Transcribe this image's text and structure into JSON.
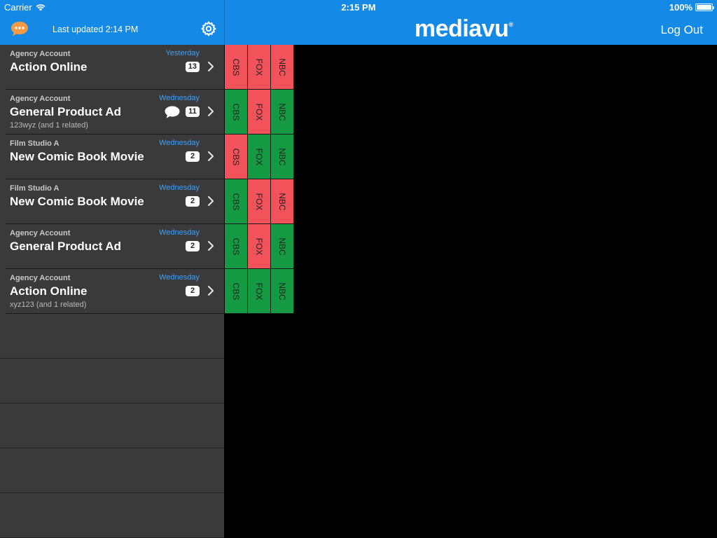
{
  "status": {
    "carrier": "Carrier",
    "time": "2:15 PM",
    "battery": "100%"
  },
  "header": {
    "last_updated": "Last updated 2:14 PM",
    "logo": "mediavu",
    "logo_mark": "®",
    "logout": "Log Out"
  },
  "colors": {
    "accent": "#1589e6",
    "red": "#f2525a",
    "green": "#139a43",
    "list_bg": "#3b3a3a",
    "chat_icon": "#f39a43"
  },
  "items": [
    {
      "account": "Agency Account",
      "title": "Action Online",
      "day": "Yesterday",
      "count": "13",
      "sub": "",
      "has_message": false
    },
    {
      "account": "Agency Account",
      "title": "General Product Ad",
      "day": "Wednesday",
      "count": "11",
      "sub": "123wyz (and 1 related)",
      "has_message": true
    },
    {
      "account": "Film Studio A",
      "title": "New Comic Book Movie",
      "day": "Wednesday",
      "count": "2",
      "sub": "",
      "has_message": false
    },
    {
      "account": "Film Studio A",
      "title": "New Comic Book Movie",
      "day": "Wednesday",
      "count": "2",
      "sub": "",
      "has_message": false
    },
    {
      "account": "Agency Account",
      "title": "General Product Ad",
      "day": "Wednesday",
      "count": "2",
      "sub": "",
      "has_message": false
    },
    {
      "account": "Agency Account",
      "title": "Action Online",
      "day": "Wednesday",
      "count": "2",
      "sub": "xyz123 (and 1 related)",
      "has_message": false
    }
  ],
  "networks": [
    "CBS",
    "FOX",
    "NBC"
  ],
  "network_status": [
    [
      "red",
      "red",
      "red"
    ],
    [
      "green",
      "red",
      "green"
    ],
    [
      "red",
      "green",
      "green"
    ],
    [
      "green",
      "red",
      "red"
    ],
    [
      "green",
      "red",
      "green"
    ],
    [
      "green",
      "green",
      "green"
    ]
  ]
}
